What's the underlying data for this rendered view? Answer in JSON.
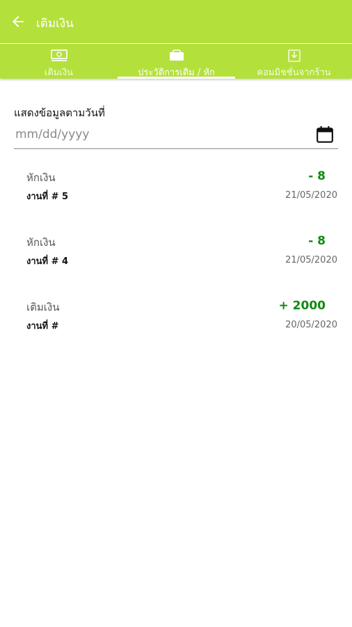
{
  "app": {
    "title": "เติมเงิน"
  },
  "tabs": [
    {
      "label": "เติมเงิน",
      "icon": "money-icon",
      "active": false
    },
    {
      "label": "ประวัติการเติม / หัก",
      "icon": "wallet-icon",
      "active": true
    },
    {
      "label": "คอมมิชชั่นจากร้าน",
      "icon": "download-box-icon",
      "active": false
    }
  ],
  "filter": {
    "label": "แสดงข้อมูลตามวันที่",
    "placeholder": "mm/dd/yyyy",
    "value": ""
  },
  "transactions": [
    {
      "type": "หักเงิน",
      "job": "งานที่ # 5",
      "amount": "- 8",
      "date": "21/05/2020"
    },
    {
      "type": "หักเงิน",
      "job": "งานที่ # 4",
      "amount": "- 8",
      "date": "21/05/2020"
    },
    {
      "type": "เติมเงิน",
      "job": "งานที่ #",
      "amount": "+ 2000",
      "date": "20/05/2020"
    }
  ],
  "colors": {
    "primary": "#b4e03c",
    "amount_green": "#0f8a0f"
  }
}
